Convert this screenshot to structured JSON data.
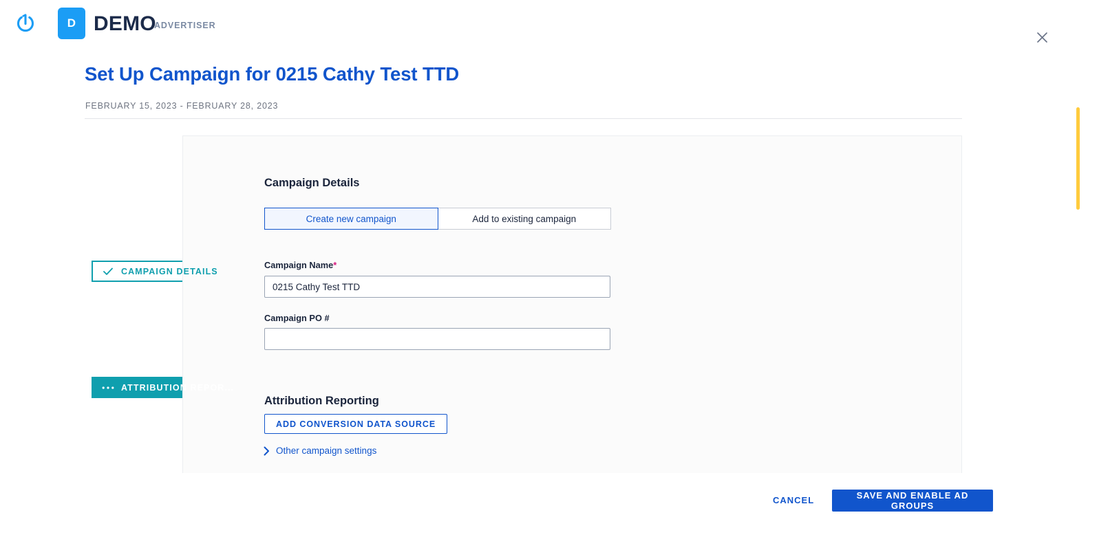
{
  "topbar": {
    "logo_icon": "power-circle-icon",
    "badge_letter": "D",
    "brand_name": "DEMO",
    "brand_subtitle": "ADVERTISER",
    "close_icon": "close-icon"
  },
  "header": {
    "title": "Set Up Campaign for 0215 Cathy Test TTD",
    "date_range": "FEBRUARY 15, 2023 - FEBRUARY 28, 2023"
  },
  "steps": [
    {
      "label": "CAMPAIGN DETAILS",
      "icon": "check-icon",
      "state": "completed",
      "color": "#0f9fae"
    },
    {
      "label": "ATTRIBUTION REPOR...",
      "icon": "ellipsis-icon",
      "state": "active",
      "color": "#0f9fae"
    }
  ],
  "campaign_details": {
    "section_title": "Campaign Details",
    "toggle": {
      "options": [
        "Create new campaign",
        "Add to existing campaign"
      ],
      "selected_index": 0
    },
    "name_field": {
      "label": "Campaign Name",
      "required_marker": "*",
      "value": "0215 Cathy Test TTD",
      "placeholder": ""
    },
    "po_field": {
      "label": "Campaign PO #",
      "value": "",
      "placeholder": ""
    }
  },
  "attribution_reporting": {
    "section_title": "Attribution Reporting",
    "add_conversion_button": "ADD CONVERSION DATA SOURCE"
  },
  "other_settings": {
    "label": "Other campaign settings",
    "icon": "chevron-right-icon",
    "expanded": false
  },
  "footer": {
    "cancel_label": "CANCEL",
    "primary_label": "SAVE AND ENABLE AD GROUPS"
  },
  "colors": {
    "primary_blue": "#1155cc",
    "brand_blue": "#1b9df5",
    "teal": "#0f9fae",
    "required_magenta": "#d6197d",
    "scrollbar_gold": "#ffcb3d",
    "card_background": "#fbfbfb"
  },
  "scrollbar": {
    "name": "vertical-scrollbar-thumb"
  }
}
